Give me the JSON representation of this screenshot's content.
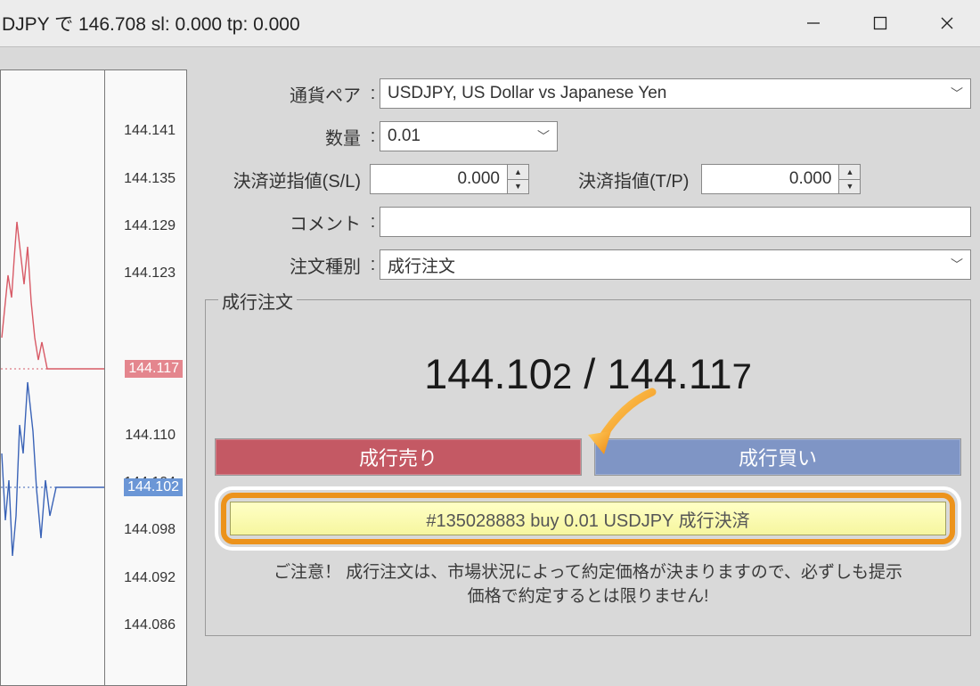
{
  "title": "DJPY で 146.708 sl: 0.000 tp: 0.000",
  "labels": {
    "symbol": "通貨ペア",
    "volume": "数量",
    "sl": "決済逆指値(S/L)",
    "tp": "決済指値(T/P)",
    "comment": "コメント",
    "order_type": "注文種別"
  },
  "fields": {
    "symbol": "USDJPY, US Dollar vs Japanese Yen",
    "volume": "0.01",
    "sl": "0.000",
    "tp": "0.000",
    "comment": "",
    "order_type": "成行注文"
  },
  "group_title": "成行注文",
  "price": {
    "bid_main": "144.10",
    "bid_last": "2",
    "ask_main": "144.11",
    "ask_last": "7",
    "sep": " / "
  },
  "buttons": {
    "sell": "成行売り",
    "buy": "成行買い"
  },
  "highlight": "#135028883 buy 0.01 USDJPY 成行決済",
  "notice_line1": "ご注意！ 成行注文は、市場状況によって約定価格が決まりますので、必ずしも提示",
  "notice_line2": "価格で約定するとは限りません!",
  "chart_data": {
    "type": "candlestick",
    "ylabel": "",
    "yticks": [
      "144.141",
      "144.135",
      "144.129",
      "144.123",
      "144.110",
      "144.104",
      "144.098",
      "144.092",
      "144.086"
    ],
    "badges": [
      {
        "value": "144.117",
        "color": "red"
      },
      {
        "value": "144.102",
        "color": "blue"
      }
    ]
  }
}
